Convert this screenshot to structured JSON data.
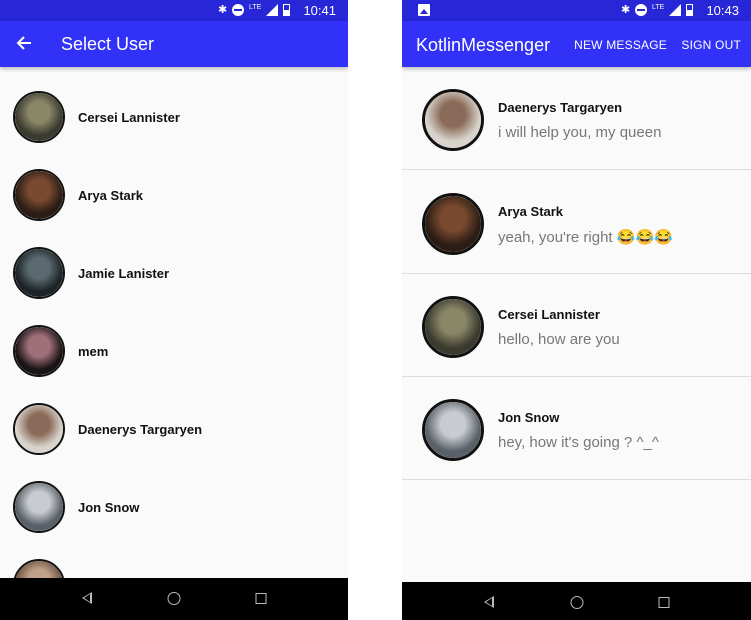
{
  "left_screen": {
    "status_time": "10:41",
    "status_lte": "LTE",
    "title": "Select User",
    "users": [
      {
        "name": "Cersei Lannister",
        "avatar_colors": [
          "#3a3a2e",
          "#8a8668"
        ]
      },
      {
        "name": "Arya Stark",
        "avatar_colors": [
          "#2b1c14",
          "#7a4a30"
        ]
      },
      {
        "name": "Jamie Lanister",
        "avatar_colors": [
          "#1c2428",
          "#5a6a6e"
        ]
      },
      {
        "name": "mem",
        "avatar_colors": [
          "#1a1416",
          "#a0707a"
        ]
      },
      {
        "name": "Daenerys Targaryen",
        "avatar_colors": [
          "#d8d4cc",
          "#8a6a58"
        ]
      },
      {
        "name": "Jon Snow",
        "avatar_colors": [
          "#5a6068",
          "#c8ccd0"
        ]
      },
      {
        "name": "",
        "avatar_colors": [
          "#6a5040",
          "#c0a088"
        ]
      }
    ]
  },
  "right_screen": {
    "status_time": "10:43",
    "status_lte": "LTE",
    "title": "KotlinMessenger",
    "actions": {
      "new_message": "NEW MESSAGE",
      "sign_out": "SIGN OUT"
    },
    "messages": [
      {
        "name": "Daenerys Targaryen",
        "text": "i will help you, my queen",
        "avatar_colors": [
          "#d8d4cc",
          "#8a6a58"
        ]
      },
      {
        "name": "Arya Stark",
        "text": "yeah, you're right 😂😂😂",
        "avatar_colors": [
          "#2b1c14",
          "#7a4a30"
        ]
      },
      {
        "name": "Cersei Lannister",
        "text": "hello, how are you",
        "avatar_colors": [
          "#3a3a2e",
          "#8a8668"
        ]
      },
      {
        "name": "Jon Snow",
        "text": "hey, how it's going ? ^_^",
        "avatar_colors": [
          "#5a6068",
          "#c8ccd0"
        ]
      }
    ]
  },
  "colors": {
    "status_bar": "#2727d8",
    "app_bar": "#3131f7",
    "nav_bar": "#000000"
  },
  "icons": {
    "status": [
      "bluetooth-icon",
      "do-not-disturb-icon",
      "lte-icon",
      "signal-icon",
      "battery-icon",
      "image-notification-icon"
    ],
    "appbar": [
      "back-arrow-icon"
    ],
    "nav": [
      "nav-back-icon",
      "nav-home-icon",
      "nav-recents-icon"
    ]
  }
}
